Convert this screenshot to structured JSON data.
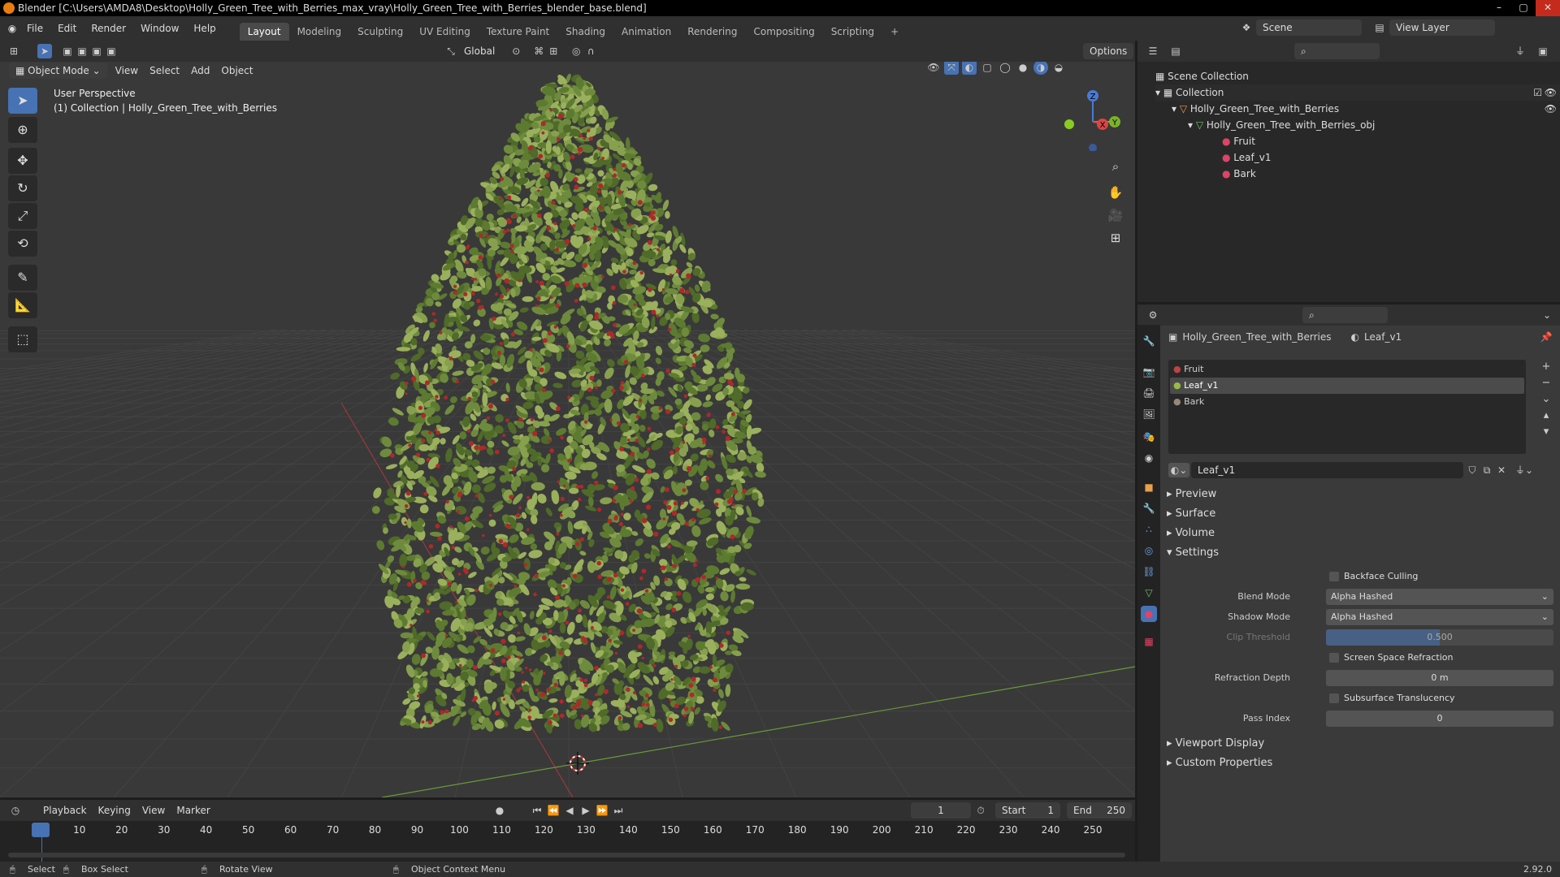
{
  "window": {
    "title": "Blender [C:\\Users\\AMDA8\\Desktop\\Holly_Green_Tree_with_Berries_max_vray\\Holly_Green_Tree_with_Berries_blender_base.blend]",
    "controls": [
      "–",
      "▢",
      "✕"
    ]
  },
  "menu": {
    "items": [
      "File",
      "Edit",
      "Render",
      "Window",
      "Help"
    ]
  },
  "workspaces": {
    "tabs": [
      "Layout",
      "Modeling",
      "Sculpting",
      "UV Editing",
      "Texture Paint",
      "Shading",
      "Animation",
      "Rendering",
      "Compositing",
      "Scripting",
      "+"
    ],
    "active": "Layout"
  },
  "topbar": {
    "scene": "Scene",
    "view_layer": "View Layer"
  },
  "viewport": {
    "transform_orientation": "Global",
    "options_label": "Options",
    "mode": "Object Mode",
    "menus": [
      "View",
      "Select",
      "Add",
      "Object"
    ],
    "overlay_title": "User Perspective",
    "overlay_sub": "(1) Collection | Holly_Green_Tree_with_Berries",
    "gizmo": {
      "z": "Z",
      "y": "Y",
      "x": "X"
    },
    "foliage_color": "#6e8b3d",
    "berry_color": "#b0282a",
    "grid_color": "#454545"
  },
  "outliner": {
    "scene_collection": "Scene Collection",
    "collection": "Collection",
    "object": "Holly_Green_Tree_with_Berries",
    "mesh": "Holly_Green_Tree_with_Berries_obj",
    "materials": [
      "Fruit",
      "Leaf_v1",
      "Bark"
    ]
  },
  "properties": {
    "breadcrumb_object": "Holly_Green_Tree_with_Berries",
    "breadcrumb_material": "Leaf_v1",
    "slots": [
      "Fruit",
      "Leaf_v1",
      "Bark"
    ],
    "active_slot": "Leaf_v1",
    "material_name": "Leaf_v1",
    "panels": {
      "preview": "Preview",
      "surface": "Surface",
      "volume": "Volume",
      "settings": "Settings",
      "viewport_display": "Viewport Display",
      "custom_properties": "Custom Properties"
    },
    "settings": {
      "backface_culling": "Backface Culling",
      "blend_mode_label": "Blend Mode",
      "blend_mode": "Alpha Hashed",
      "shadow_mode_label": "Shadow Mode",
      "shadow_mode": "Alpha Hashed",
      "clip_threshold_label": "Clip Threshold",
      "clip_threshold": "0.500",
      "screen_space_refraction": "Screen Space Refraction",
      "refraction_depth_label": "Refraction Depth",
      "refraction_depth": "0 m",
      "subsurface_translucency": "Subsurface Translucency",
      "pass_index_label": "Pass Index",
      "pass_index": "0"
    }
  },
  "timeline": {
    "menus": [
      "Playback",
      "Keying",
      "View",
      "Marker"
    ],
    "current_frame": "1",
    "start_label": "Start",
    "start": "1",
    "end_label": "End",
    "end": "250",
    "ticks": [
      "1",
      "10",
      "20",
      "30",
      "40",
      "50",
      "60",
      "70",
      "80",
      "90",
      "100",
      "110",
      "120",
      "130",
      "140",
      "150",
      "160",
      "170",
      "180",
      "190",
      "200",
      "210",
      "220",
      "230",
      "240",
      "250"
    ]
  },
  "status": {
    "select": "Select",
    "box_select": "Box Select",
    "rotate_view": "Rotate View",
    "context_menu": "Object Context Menu",
    "version": "2.92.0"
  }
}
